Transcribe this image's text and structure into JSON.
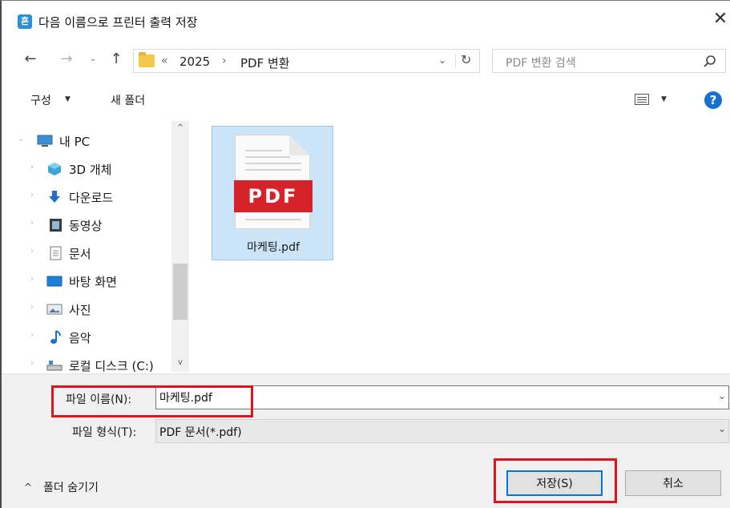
{
  "window": {
    "app_icon_glyph": "흔",
    "title": "다음 이름으로 프린터 출력 저장",
    "close_glyph": "✕"
  },
  "address_bar": {
    "back_glyph": "←",
    "forward_glyph": "→",
    "recent_glyph": "⌄",
    "up_glyph": "↑",
    "overflow_glyph": "«",
    "separator_glyph": "›",
    "breadcrumbs": [
      "2025",
      "PDF 변환"
    ],
    "dropdown_glyph": "⌄",
    "refresh_glyph": "↻",
    "search_placeholder": "PDF 변환 검색"
  },
  "toolbar": {
    "organize_label": "구성",
    "organize_arrow": "▼",
    "new_folder_label": "새 폴더",
    "view_arrow": "▼",
    "help_glyph": "?"
  },
  "nav_tree": [
    {
      "label": "내 PC",
      "icon": "computer-icon",
      "chevron": "⌄"
    },
    {
      "label": "3D 개체",
      "icon": "cube-icon",
      "chevron": "›"
    },
    {
      "label": "다운로드",
      "icon": "download-arrow-icon",
      "chevron": "›"
    },
    {
      "label": "동영상",
      "icon": "video-film-icon",
      "chevron": "›"
    },
    {
      "label": "문서",
      "icon": "document-icon",
      "chevron": "›"
    },
    {
      "label": "바탕 화면",
      "icon": "desktop-icon",
      "chevron": "›"
    },
    {
      "label": "사진",
      "icon": "picture-icon",
      "chevron": "›"
    },
    {
      "label": "음악",
      "icon": "music-note-icon",
      "chevron": "›"
    },
    {
      "label": "로컬 디스크 (C:)",
      "icon": "local-disk-icon",
      "chevron": "›"
    }
  ],
  "scrollbar": {
    "up_glyph": "^",
    "down_glyph": "v"
  },
  "files": [
    {
      "name": "마케팅.pdf",
      "badge": "PDF"
    }
  ],
  "form": {
    "filename_label": "파일 이름(N):",
    "filename_value": "마케팅.pdf",
    "filetype_label": "파일 형식(T):",
    "filetype_value": "PDF 문서(*.pdf)",
    "dropdown_glyph": "⌄"
  },
  "footer": {
    "hide_folders_arrow": "^",
    "hide_folders_label": "폴더 숨기기",
    "save_label": "저장(S)",
    "cancel_label": "취소"
  },
  "colors": {
    "accent": "#0078d7",
    "highlight": "#e0141c",
    "pdf_red": "#d6222a",
    "selection": "#cce4f7"
  }
}
